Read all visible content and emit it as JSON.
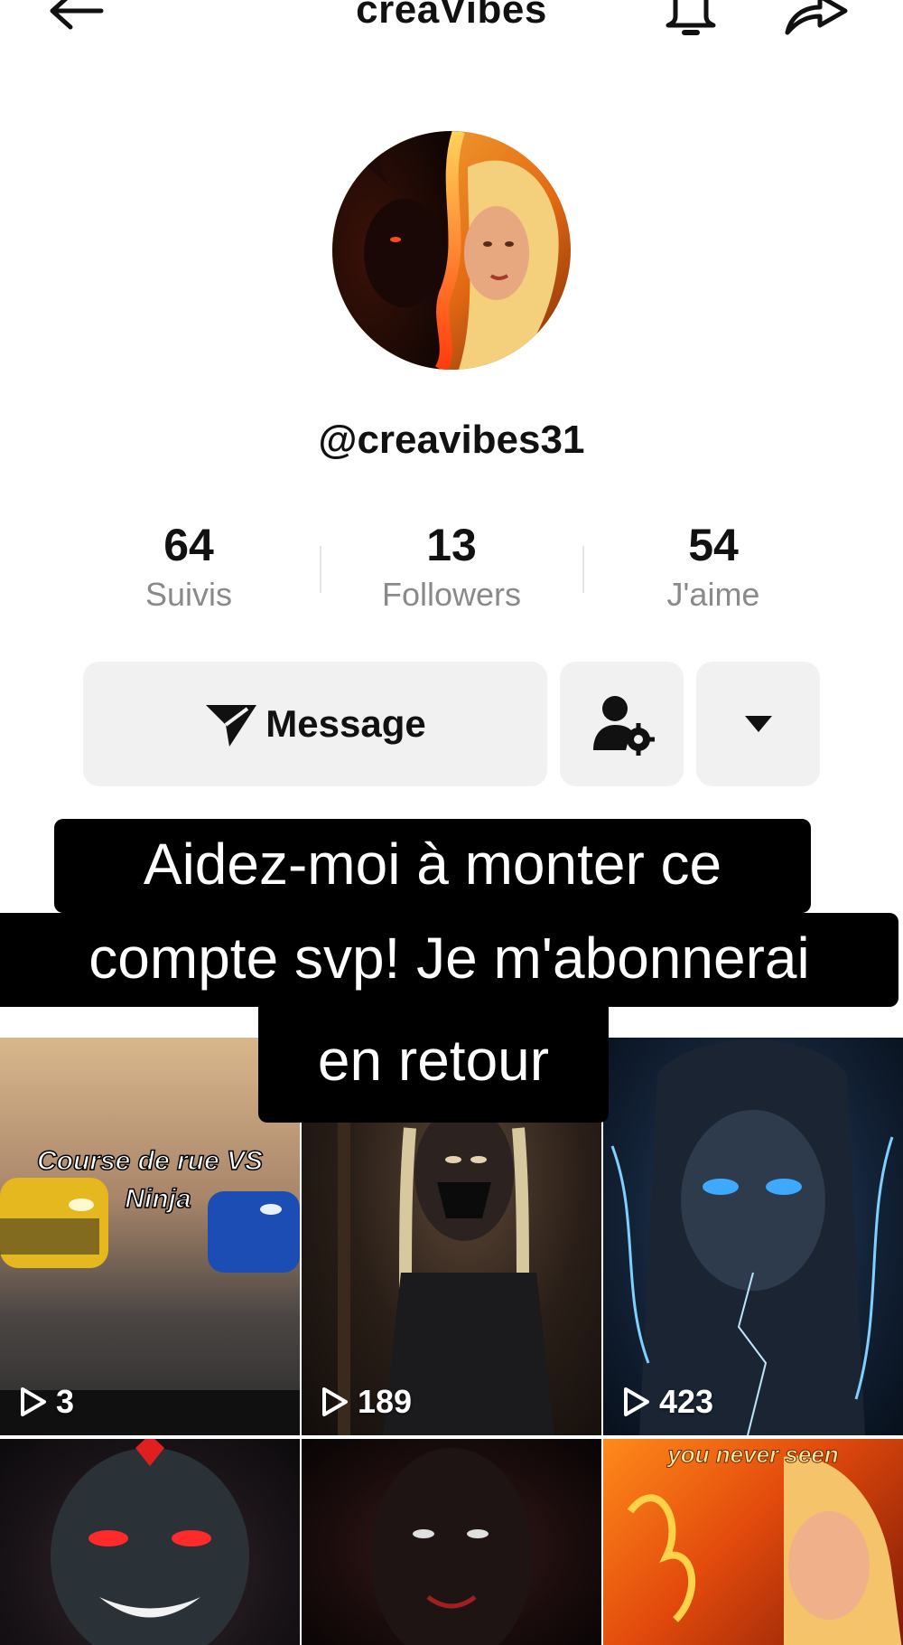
{
  "header": {
    "title": "creaVibes",
    "back_icon": "arrow-left-icon",
    "bell_icon": "bell-icon",
    "share_icon": "share-arrow-icon"
  },
  "profile": {
    "username": "@creavibes31",
    "avatar_description_icon": "avatar-fire-demon-angel"
  },
  "stats": [
    {
      "value": "64",
      "label": "Suivis"
    },
    {
      "value": "13",
      "label": "Followers"
    },
    {
      "value": "54",
      "label": "J'aime"
    }
  ],
  "actions": {
    "message_label": "Message",
    "message_icon": "send-paper-plane-icon",
    "person_settings_icon": "person-gear-icon",
    "more_icon": "caret-down-icon"
  },
  "caption": {
    "line1": "Aidez-moi à monter ce",
    "line2": "compte svp! Je m'abonnerai",
    "line3": "en retour"
  },
  "videos": [
    {
      "views": "3",
      "overlay_text_1": "Course de rue VS",
      "overlay_text_2": "Ninja"
    },
    {
      "views": "189"
    },
    {
      "views": "423"
    },
    {
      "views": ""
    },
    {
      "views": ""
    },
    {
      "views": "",
      "overlay_text_1": "you never seen"
    }
  ],
  "colors": {
    "button_bg": "#f1f1f2",
    "muted_text": "#8a8a8a",
    "caption_bg": "#000000"
  }
}
